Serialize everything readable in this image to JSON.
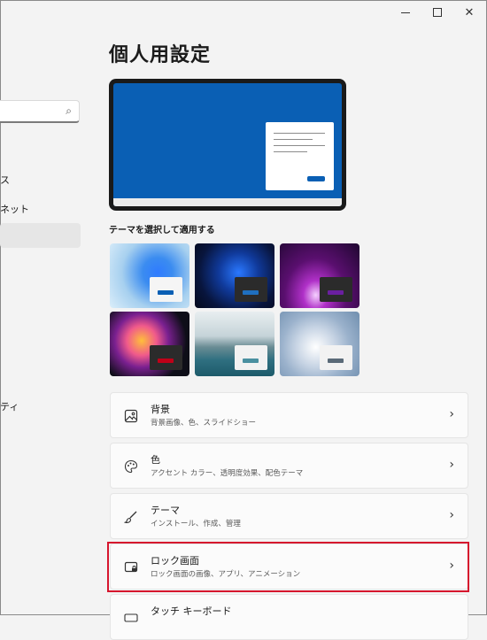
{
  "nav": {
    "item_1": "ス",
    "item_2": "ネット",
    "item_3": "ティ"
  },
  "page_title": "個人用設定",
  "themes_label": "テーマを選択して適用する",
  "themes": [
    {
      "name": "windows-light",
      "accent": "#0a5fb4"
    },
    {
      "name": "windows-dark",
      "accent": "#1f6fbf"
    },
    {
      "name": "glow",
      "accent": "#6a1fa0"
    },
    {
      "name": "captured-motion",
      "accent": "#c00018"
    },
    {
      "name": "sunrise",
      "accent": "#4a90a0"
    },
    {
      "name": "flow",
      "accent": "#5a6a78"
    }
  ],
  "settings": [
    {
      "title": "背景",
      "subtitle": "背景画像、色、スライドショー",
      "icon": "image-icon"
    },
    {
      "title": "色",
      "subtitle": "アクセント カラー、透明度効果、配色テーマ",
      "icon": "palette-icon"
    },
    {
      "title": "テーマ",
      "subtitle": "インストール、作成、管理",
      "icon": "brush-icon"
    },
    {
      "title": "ロック画面",
      "subtitle": "ロック画面の画像、アプリ、アニメーション",
      "icon": "lock-screen-icon"
    },
    {
      "title": "タッチ キーボード",
      "subtitle": "",
      "icon": "keyboard-icon"
    }
  ],
  "colors": {
    "accent": "#0a5fb4",
    "highlight": "#d6152d"
  }
}
